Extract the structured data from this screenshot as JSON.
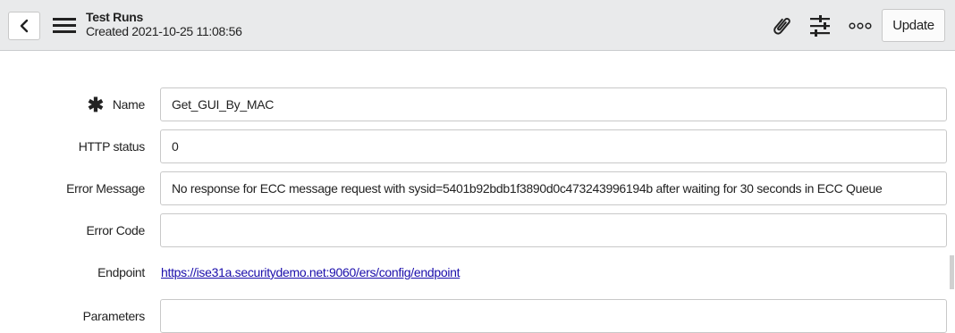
{
  "header": {
    "record_type": "Test Runs",
    "record_subtitle": "Created 2021-10-25 11:08:56",
    "update_label": "Update",
    "icons": [
      "back-icon",
      "menu-icon",
      "paperclip-icon",
      "settings-sliders-icon",
      "more-icon"
    ]
  },
  "form": {
    "name": {
      "label": "Name",
      "value": "Get_GUI_By_MAC",
      "required_marker": "✱"
    },
    "http_status": {
      "label": "HTTP status",
      "value": "0"
    },
    "error_message": {
      "label": "Error Message",
      "value": "No response for ECC message request with sysid=5401b92bdb1f3890d0c473243996194b after waiting for 30 seconds in ECC Queue"
    },
    "error_code": {
      "label": "Error Code",
      "value": ""
    },
    "endpoint": {
      "label": "Endpoint",
      "value": "https://ise31a.securitydemo.net:9060/ers/config/endpoint"
    },
    "parameters": {
      "label": "Parameters",
      "value": ""
    }
  }
}
